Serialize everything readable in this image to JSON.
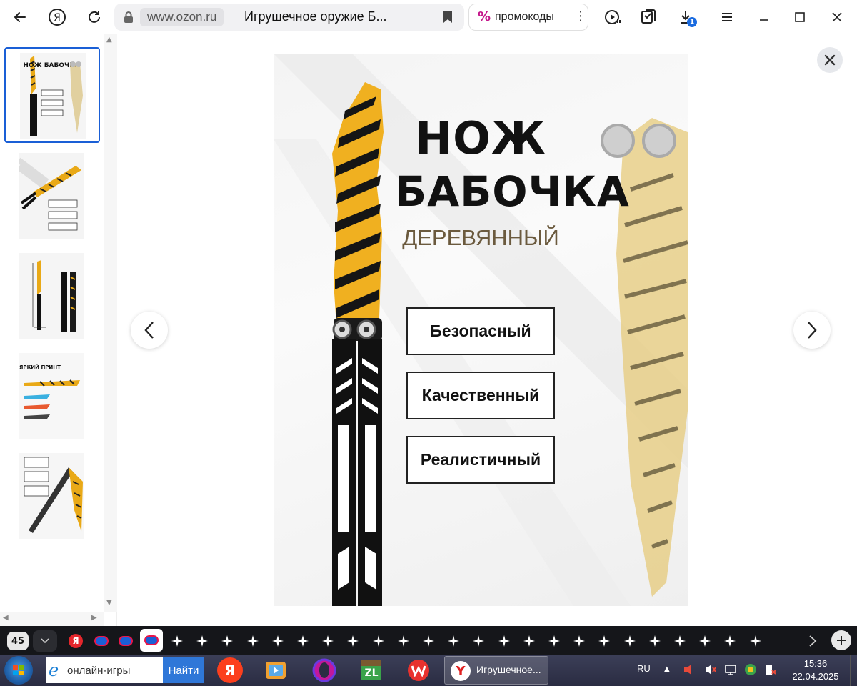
{
  "browser": {
    "domain": "www.ozon.ru",
    "tab_title": "Игрушечное оружие Б...",
    "promo_label": "промокоды",
    "promo_symbol": "%",
    "downloads_badge": "1",
    "icons": [
      "back-icon",
      "yandex-icon",
      "reload-icon",
      "lock-icon",
      "bookmark-icon",
      "more-icon",
      "media-icon",
      "collections-icon",
      "downloads-icon",
      "menu-icon",
      "minimize-icon",
      "maximize-icon",
      "close-icon"
    ]
  },
  "product": {
    "title_line1": "НОЖ",
    "title_line2": "БАБОЧКА",
    "subtitle": "ДЕРЕВЯННЫЙ",
    "features": [
      "Безопасный",
      "Качественный",
      "Реалистичный"
    ],
    "colors": {
      "tiger_yellow": "#f0b020",
      "tiger_dark": "#1a1a1a",
      "subtitle": "#6b5a3e"
    }
  },
  "thumbnails": {
    "count": 5,
    "active_index": 0,
    "items": [
      {
        "caption": "НОЖ БАБОЧКА"
      },
      {
        "caption": ""
      },
      {
        "caption": ""
      },
      {
        "caption": "ЯРКИЙ ПРИНТ"
      },
      {
        "caption": ""
      }
    ]
  },
  "tabstrip": {
    "tab_count": "45",
    "pinned_favicon": "Я",
    "star_count": 24
  },
  "taskbar": {
    "search_value": "онлайн-игры",
    "search_button": "Найти",
    "active_task_title": "Игрушечное...",
    "language": "RU",
    "time": "15:36",
    "date": "22.04.2025"
  }
}
